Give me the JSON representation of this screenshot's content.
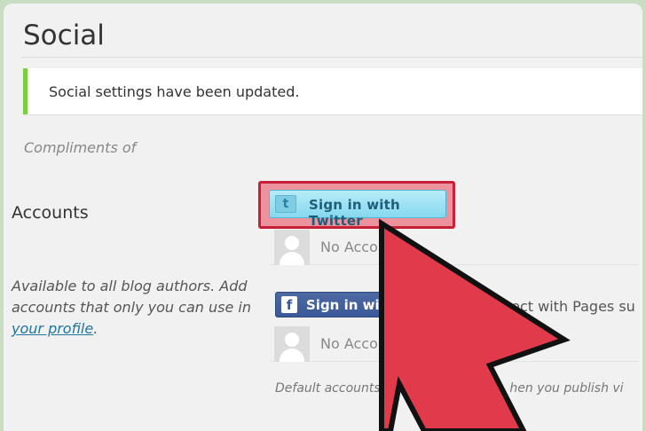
{
  "page": {
    "title": "Social",
    "notice": "Social settings have been updated.",
    "compliments": "Compliments of"
  },
  "accounts": {
    "label": "Accounts",
    "description_prefix": "Available to all blog authors. Add accounts that only you can use in ",
    "description_link": "your profile",
    "description_suffix": ".",
    "twitter_button": "Sign in with Twitter",
    "twitter_icon": "t",
    "twitter_account": "No Accou",
    "facebook_button": "Sign in with F",
    "facebook_icon": "f",
    "facebook_hint": "nect with Pages su",
    "facebook_account": "No Account",
    "default_note": "Default accounts wil",
    "default_note_tail": "hen you publish vi"
  },
  "colors": {
    "notice_border": "#7ad03a",
    "highlight": "#c9203a",
    "arrow_fill": "#e13a4a",
    "twitter_button": "#9ee2f2",
    "facebook_button": "#3b5998"
  },
  "icons": {
    "twitter": "twitter-icon",
    "facebook": "facebook-icon",
    "avatar": "default-avatar-icon",
    "pointer": "arrow-pointer"
  }
}
